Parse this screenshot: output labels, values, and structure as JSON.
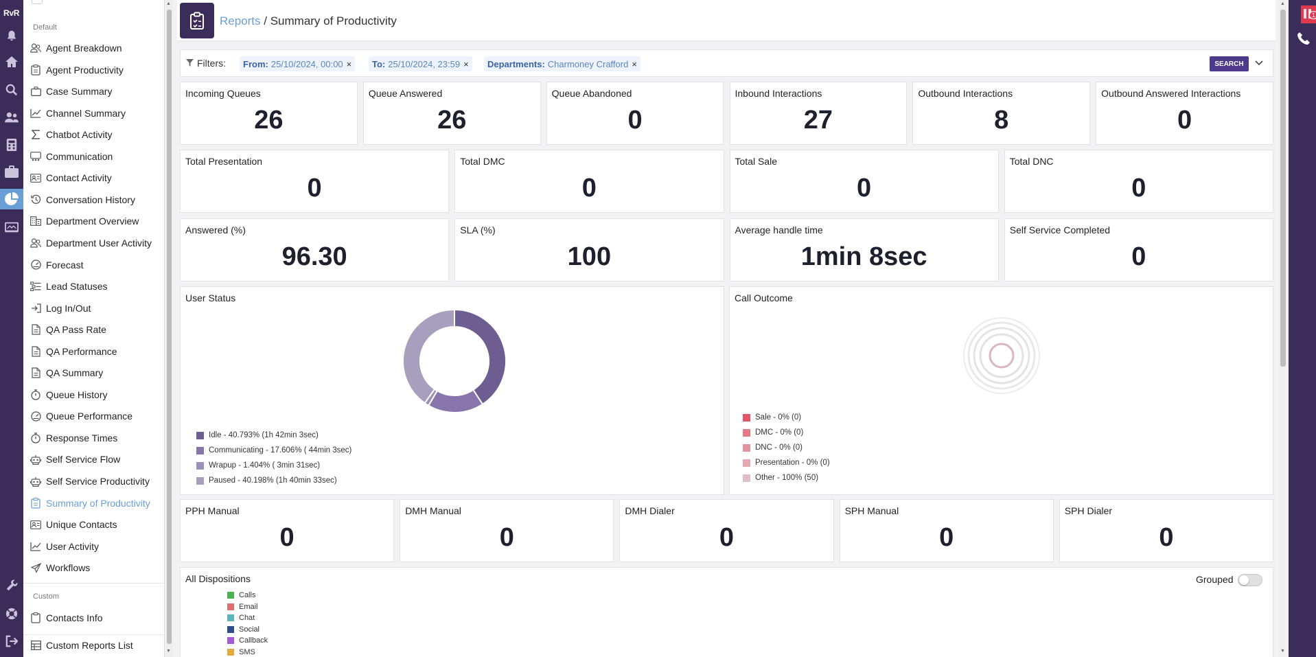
{
  "rail": {
    "logo": "RvR",
    "icons": [
      "bell-icon",
      "home-icon",
      "search-icon",
      "users-icon",
      "calculator-icon",
      "briefcase-icon",
      "pie-chart-icon",
      "monitor-icon",
      "wrench-icon",
      "support-icon",
      "logout-icon"
    ]
  },
  "sidebar": {
    "default_title": "Default",
    "items": [
      {
        "label": "Agent Breakdown",
        "icon": "users-icon"
      },
      {
        "label": "Agent Productivity",
        "icon": "clipboard-icon"
      },
      {
        "label": "Case Summary",
        "icon": "briefcase-icon"
      },
      {
        "label": "Channel Summary",
        "icon": "chart-line-icon"
      },
      {
        "label": "Chatbot Activity",
        "icon": "sigma-icon"
      },
      {
        "label": "Communication",
        "icon": "chat-group-icon"
      },
      {
        "label": "Contact Activity",
        "icon": "contact-card-icon"
      },
      {
        "label": "Conversation History",
        "icon": "history-icon"
      },
      {
        "label": "Department Overview",
        "icon": "building-icon"
      },
      {
        "label": "Department User Activity",
        "icon": "users-icon"
      },
      {
        "label": "Forecast",
        "icon": "gauge-icon"
      },
      {
        "label": "Lead Statuses",
        "icon": "list-icon"
      },
      {
        "label": "Log In/Out",
        "icon": "login-icon"
      },
      {
        "label": "QA Pass Rate",
        "icon": "document-icon"
      },
      {
        "label": "QA Performance",
        "icon": "document-icon"
      },
      {
        "label": "QA Summary",
        "icon": "document-icon"
      },
      {
        "label": "Queue History",
        "icon": "stopwatch-icon"
      },
      {
        "label": "Queue Performance",
        "icon": "gauge-icon"
      },
      {
        "label": "Response Times",
        "icon": "stopwatch-icon"
      },
      {
        "label": "Self Service Flow",
        "icon": "robot-icon"
      },
      {
        "label": "Self Service Productivity",
        "icon": "robot-icon"
      },
      {
        "label": "Summary of Productivity",
        "icon": "clipboard-icon",
        "active": true
      },
      {
        "label": "Unique Contacts",
        "icon": "contact-card-icon"
      },
      {
        "label": "User Activity",
        "icon": "chart-line-icon"
      },
      {
        "label": "Workflows",
        "icon": "send-icon"
      }
    ],
    "custom_title": "Custom",
    "custom_items": [
      {
        "label": "Contacts Info",
        "icon": "clipboard-icon"
      }
    ],
    "footer_item": {
      "label": "Custom Reports List",
      "icon": "table-icon"
    }
  },
  "header": {
    "breadcrumb_link": "Reports",
    "breadcrumb_sep": " / ",
    "title": "Summary of Productivity"
  },
  "filters": {
    "label": "Filters:",
    "chips": [
      {
        "key": "From:",
        "value": "25/10/2024, 00:00"
      },
      {
        "key": "To:",
        "value": "25/10/2024, 23:59"
      },
      {
        "key": "Departments:",
        "value": "Charmoney Crafford"
      }
    ],
    "search_label": "SEARCH"
  },
  "stats": {
    "row1": [
      {
        "label": "Incoming Queues",
        "value": "26"
      },
      {
        "label": "Queue Answered",
        "value": "26"
      },
      {
        "label": "Queue Abandoned",
        "value": "0"
      },
      {
        "label": "Inbound Interactions",
        "value": "27"
      },
      {
        "label": "Outbound Interactions",
        "value": "8"
      },
      {
        "label": "Outbound Answered Interactions",
        "value": "0"
      }
    ],
    "row2": [
      {
        "label": "Total Presentation",
        "value": "0"
      },
      {
        "label": "Total DMC",
        "value": "0"
      },
      {
        "label": "Total Sale",
        "value": "0"
      },
      {
        "label": "Total DNC",
        "value": "0"
      }
    ],
    "row3": [
      {
        "label": "Answered (%)",
        "value": "96.30"
      },
      {
        "label": "SLA (%)",
        "value": "100"
      },
      {
        "label": "Average handle time",
        "value": "1min 8sec"
      },
      {
        "label": "Self Service Completed",
        "value": "0"
      }
    ],
    "row4": [
      {
        "label": "PPH Manual",
        "value": "0"
      },
      {
        "label": "DMH Manual",
        "value": "0"
      },
      {
        "label": "DMH Dialer",
        "value": "0"
      },
      {
        "label": "SPH Manual",
        "value": "0"
      },
      {
        "label": "SPH Dialer",
        "value": "0"
      }
    ]
  },
  "user_status": {
    "title": "User Status",
    "legend": [
      {
        "label": "Idle - 40.793% (1h 42min 3sec)",
        "value": 40.793,
        "color": "#6e5d91"
      },
      {
        "label": "Communicating - 17.606% ( 44min 3sec)",
        "value": 17.606,
        "color": "#8875ab"
      },
      {
        "label": "Wrapup - 1.404% ( 3min 31sec)",
        "value": 1.404,
        "color": "#9d90b8"
      },
      {
        "label": "Paused - 40.198% (1h 40min 33sec)",
        "value": 40.198,
        "color": "#a89fbf"
      }
    ]
  },
  "call_outcome": {
    "title": "Call Outcome",
    "legend": [
      {
        "label": "Sale - 0% (0)",
        "color": "#e0566b"
      },
      {
        "label": "DMC - 0% (0)",
        "color": "#e07a86"
      },
      {
        "label": "DNC - 0% (0)",
        "color": "#e0959d"
      },
      {
        "label": "Presentation - 0% (0)",
        "color": "#e3aab0"
      },
      {
        "label": "Other - 100% (50)",
        "color": "#e0bfc2"
      }
    ]
  },
  "dispositions": {
    "title": "All Dispositions",
    "grouped_label": "Grouped",
    "grouped_on": false,
    "legend": [
      {
        "label": "Calls",
        "color": "#4caf50"
      },
      {
        "label": "Email",
        "color": "#e07070"
      },
      {
        "label": "Chat",
        "color": "#5ab4c0"
      },
      {
        "label": "Social",
        "color": "#2f4d8a"
      },
      {
        "label": "Callback",
        "color": "#a45ad8"
      },
      {
        "label": "SMS",
        "color": "#e5a83a"
      }
    ]
  },
  "notifications": {
    "count": "1"
  }
}
